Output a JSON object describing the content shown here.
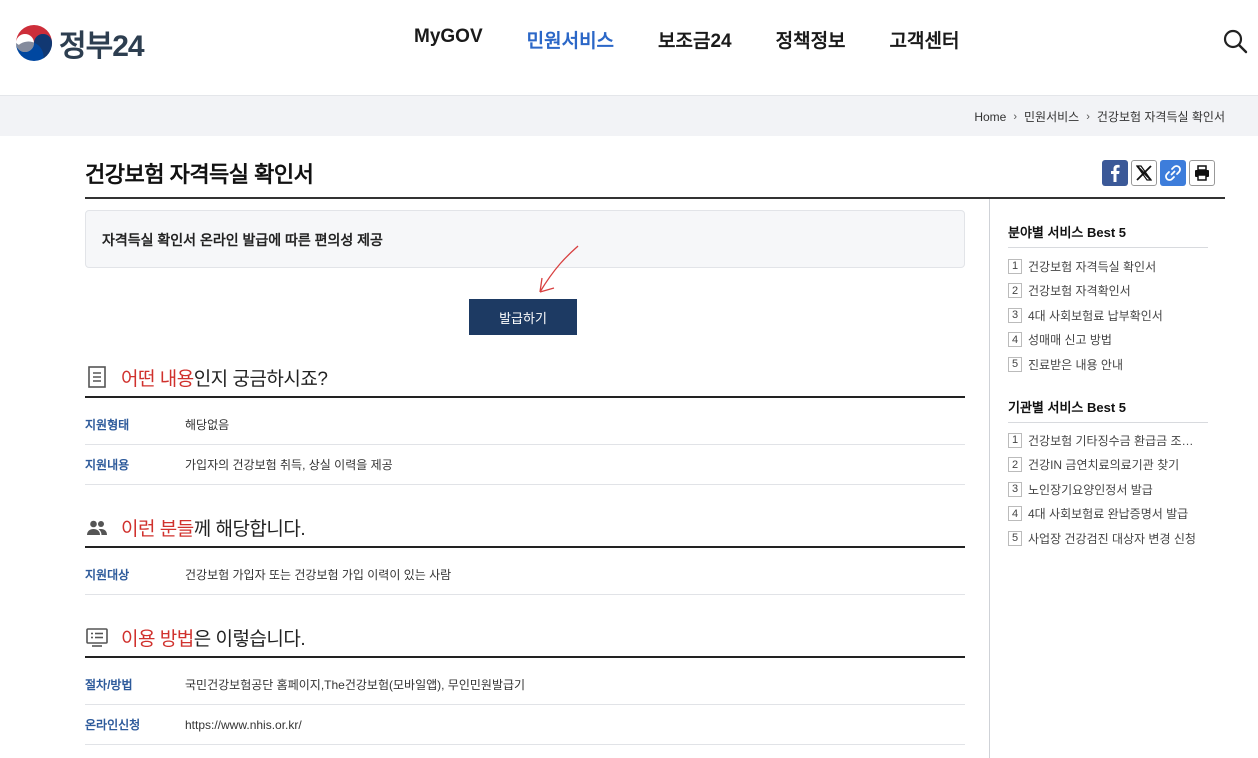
{
  "header": {
    "logo_text": "정부24",
    "nav": [
      {
        "label": "MyGOV",
        "active": false
      },
      {
        "label": "민원서비스",
        "active": true
      },
      {
        "label": "보조금24",
        "active": false
      },
      {
        "label": "정책정보",
        "active": false
      },
      {
        "label": "고객센터",
        "active": false
      }
    ],
    "search_icon": "search-icon"
  },
  "breadcrumb": [
    "Home",
    "민원서비스",
    "건강보험 자격득실 확인서"
  ],
  "page": {
    "title": "건강보험 자격득실 확인서",
    "share_icons": [
      "facebook-icon",
      "x-icon",
      "link-icon",
      "print-icon"
    ]
  },
  "summary": "자격득실 확인서 온라인 발급에 따른 편의성 제공",
  "issue_button": "발급하기",
  "sections": [
    {
      "icon": "document-icon",
      "heading_red": "어떤 내용",
      "heading_rest": "인지 궁금하시죠?",
      "rows": [
        {
          "key": "지원형태",
          "value": "해당없음"
        },
        {
          "key": "지원내용",
          "value": "가입자의 건강보험 취득, 상실 이력을 제공"
        }
      ]
    },
    {
      "icon": "people-icon",
      "heading_red": "이런 분들",
      "heading_rest": "께 해당합니다.",
      "rows": [
        {
          "key": "지원대상",
          "value": "건강보험 가입자 또는 건강보험 가입 이력이 있는 사람"
        }
      ]
    },
    {
      "icon": "list-icon",
      "heading_red": "이용 방법",
      "heading_rest": "은 이렇습니다.",
      "rows": [
        {
          "key": "절차/방법",
          "value": "국민건강보험공단 홈페이지,The건강보험(모바일앱), 무인민원발급기"
        },
        {
          "key": "온라인신청",
          "value": "https://www.nhis.or.kr/"
        }
      ]
    }
  ],
  "sidebar": {
    "best_by_field": {
      "title": "분야별 서비스 Best 5",
      "items": [
        {
          "num": "1",
          "label": "건강보험 자격득실 확인서"
        },
        {
          "num": "2",
          "label": "건강보험 자격확인서"
        },
        {
          "num": "3",
          "label": "4대 사회보험료 납부확인서"
        },
        {
          "num": "4",
          "label": "성매매 신고 방법"
        },
        {
          "num": "5",
          "label": "진료받은 내용 안내"
        }
      ]
    },
    "best_by_agency": {
      "title": "기관별 서비스 Best 5",
      "items": [
        {
          "num": "1",
          "label": "건강보험 기타징수금 환급금 조…"
        },
        {
          "num": "2",
          "label": "건강IN 금연치료의료기관 찾기"
        },
        {
          "num": "3",
          "label": "노인장기요양인정서 발급"
        },
        {
          "num": "4",
          "label": "4대 사회보험료 완납증명서 발급"
        },
        {
          "num": "5",
          "label": "사업장 건강검진 대상자 변경 신청"
        }
      ]
    }
  },
  "colors": {
    "accent_blue": "#2b67c7",
    "button_navy": "#1d3a63",
    "highlight_red": "#d0312d",
    "key_blue": "#2d5a9b"
  }
}
